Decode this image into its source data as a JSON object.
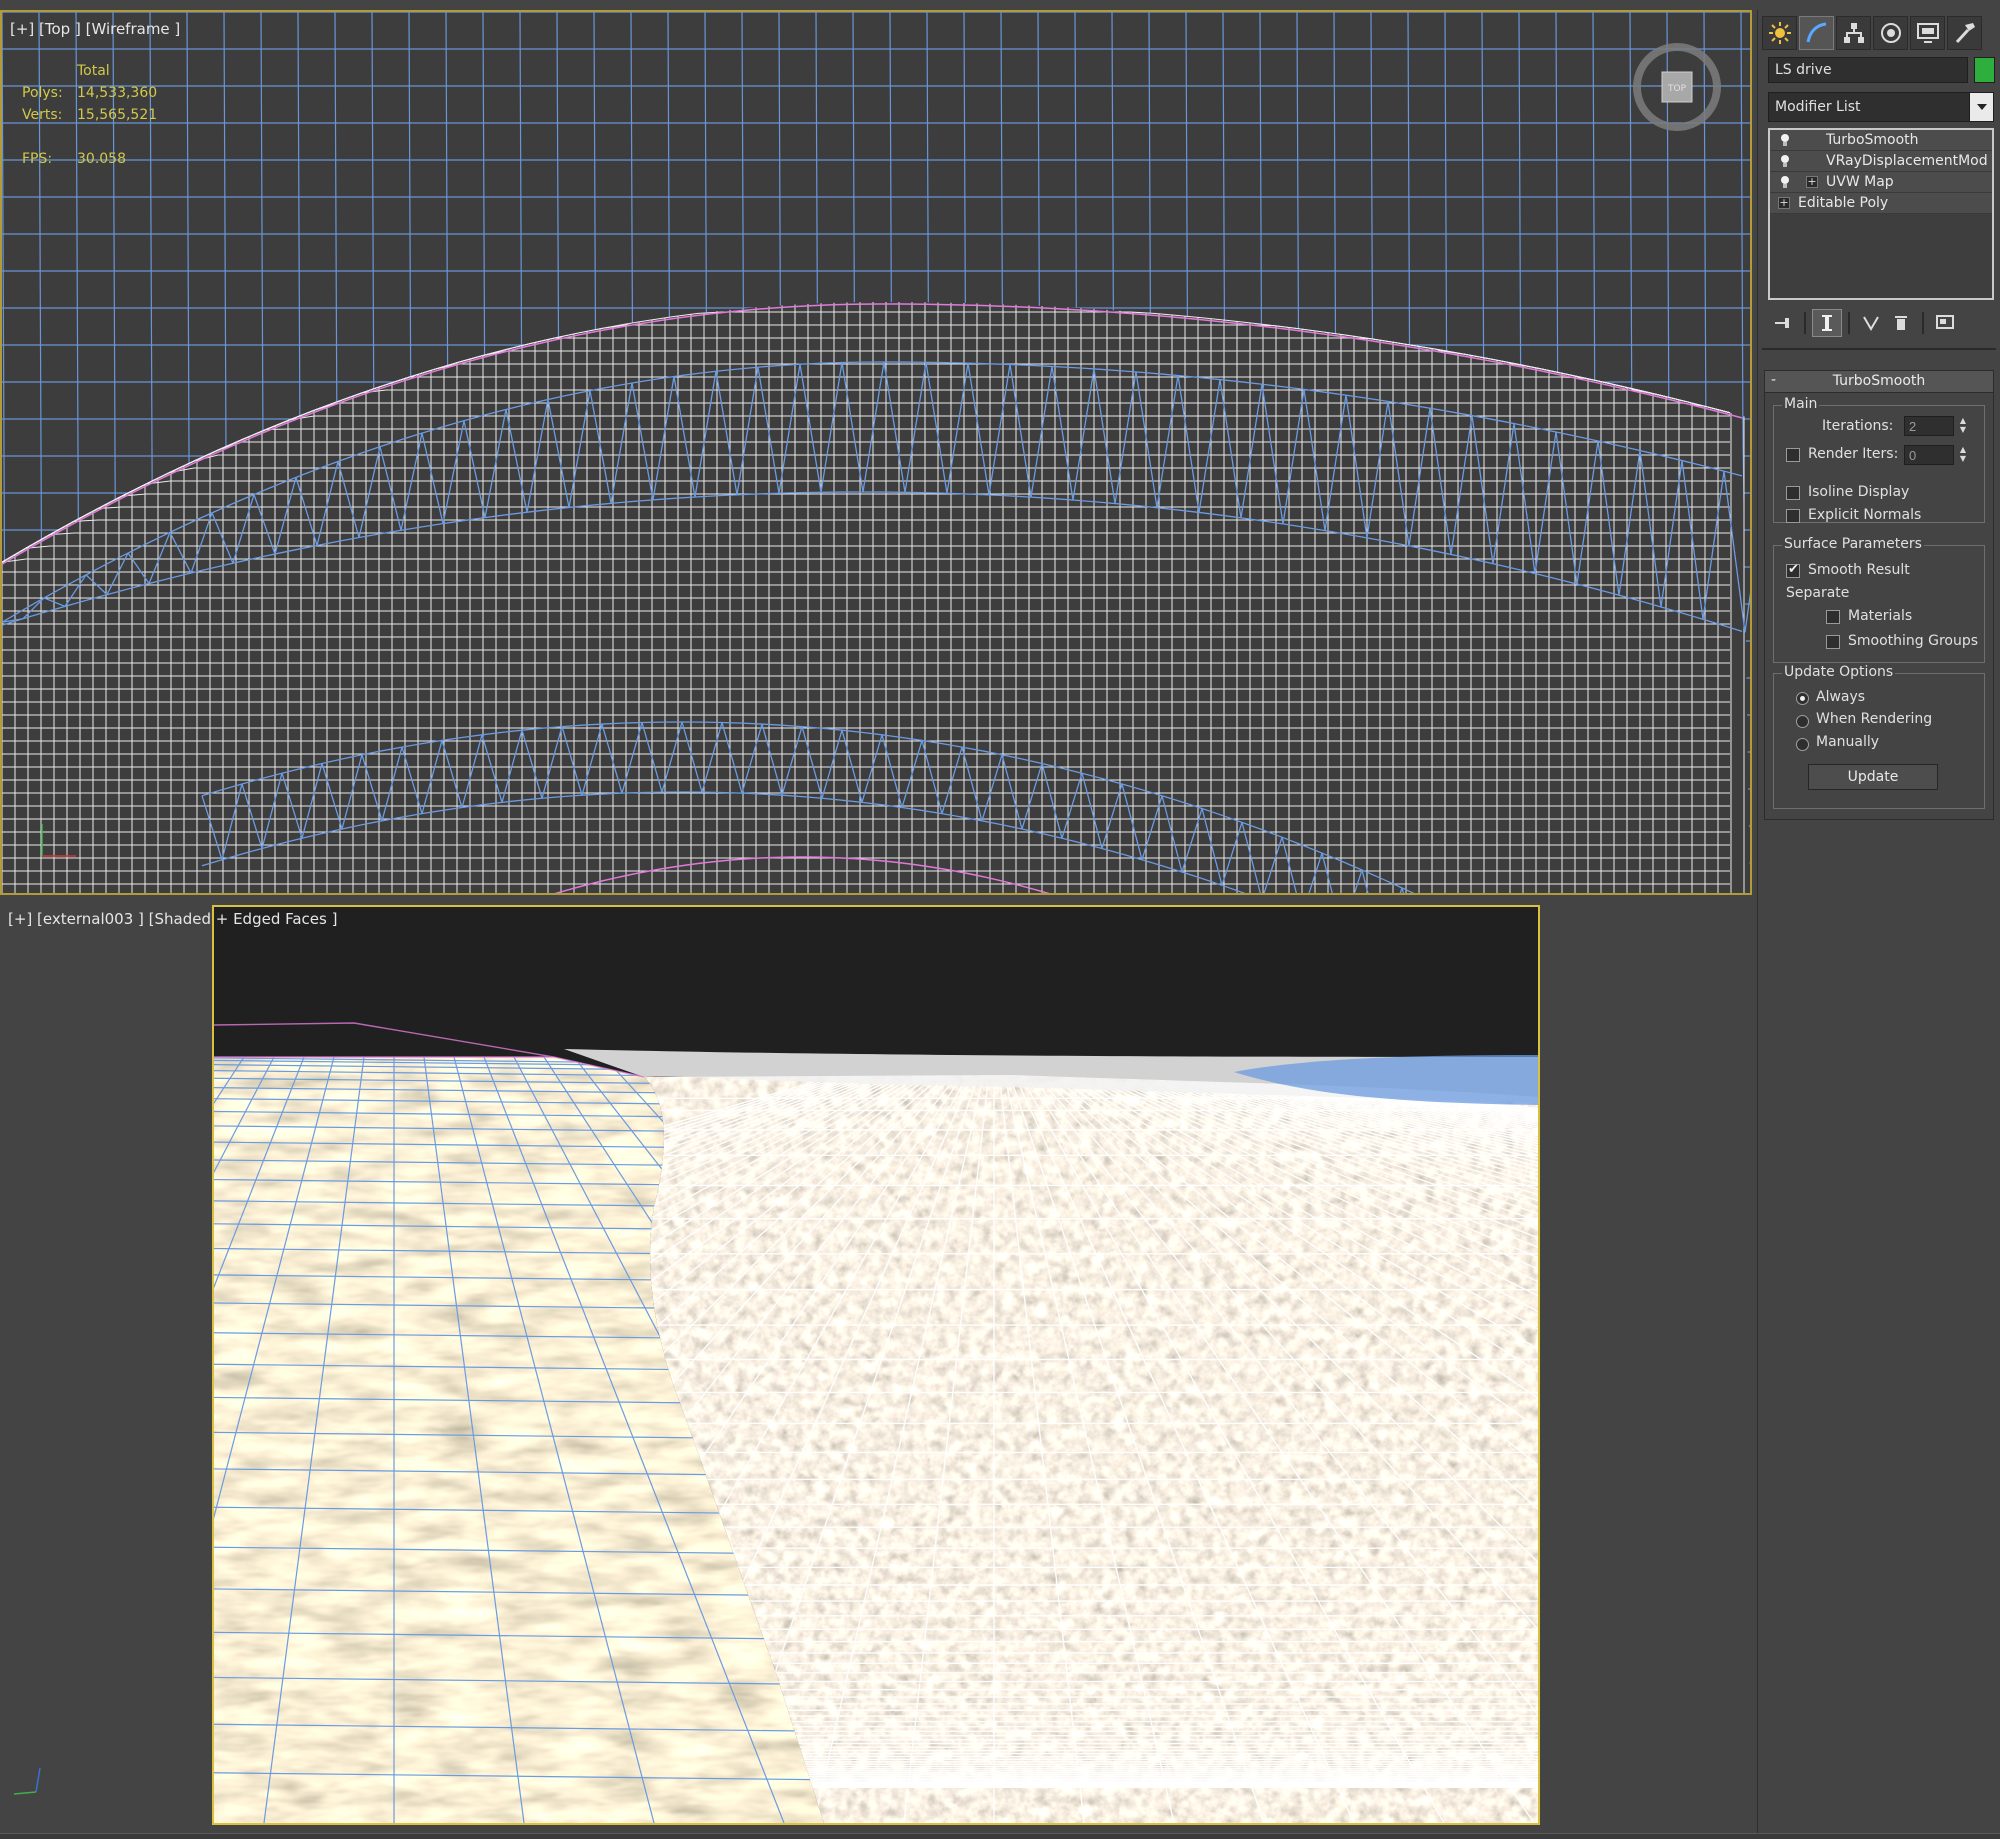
{
  "viewports": {
    "top": {
      "label": "[+] [Top ] [Wireframe ]",
      "stats": {
        "total_label": "Total",
        "polys_label": "Polys:",
        "polys_value": "14,533,360",
        "verts_label": "Verts:",
        "verts_value": "15,565,521",
        "fps_label": "FPS:",
        "fps_value": "30.058"
      },
      "viewcube_label": "TOP"
    },
    "perspective": {
      "label": "[+] [external003 ] [Shaded + Edged Faces ]"
    }
  },
  "command_panel": {
    "tabs": [
      "create-icon",
      "modify-icon",
      "hierarchy-icon",
      "motion-icon",
      "display-icon",
      "utilities-icon"
    ],
    "object_name": "LS drive",
    "object_color": "#2eae3c",
    "modifier_list_label": "Modifier List",
    "stack": [
      {
        "name": "TurboSmooth",
        "has_bulb": true,
        "has_plus": false
      },
      {
        "name": "VRayDisplacementMod",
        "has_bulb": true,
        "has_plus": false
      },
      {
        "name": "UVW Map",
        "has_bulb": true,
        "has_plus": true
      },
      {
        "name": "Editable Poly",
        "has_bulb": false,
        "has_plus": true
      }
    ],
    "rollout": {
      "collapse": "-",
      "title": "TurboSmooth",
      "main": {
        "title": "Main",
        "iterations_label": "Iterations:",
        "iterations_value": "2",
        "render_iters_label": "Render Iters:",
        "render_iters_value": "0",
        "render_iters_checked": false,
        "isoline_display_label": "Isoline Display",
        "isoline_display_checked": false,
        "explicit_normals_label": "Explicit Normals",
        "explicit_normals_checked": false
      },
      "surface": {
        "title": "Surface Parameters",
        "smooth_result_label": "Smooth Result",
        "smooth_result_checked": true,
        "separate_label": "Separate",
        "materials_label": "Materials",
        "materials_checked": false,
        "smoothing_groups_label": "Smoothing Groups",
        "smoothing_groups_checked": false
      },
      "update_options": {
        "title": "Update Options",
        "always_label": "Always",
        "when_rendering_label": "When Rendering",
        "manually_label": "Manually",
        "selected": "always",
        "update_button": "Update"
      }
    }
  },
  "colors": {
    "viewport_active_border": "#d8c13e",
    "stats_text": "#d2c84a",
    "wire_blue": "#6b9be0",
    "wire_white": "#ffffff",
    "selection_pink": "#e07ad8"
  }
}
